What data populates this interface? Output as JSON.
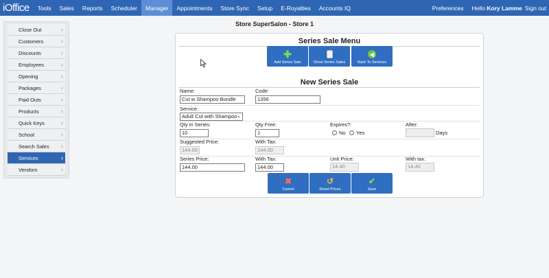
{
  "app": {
    "logo": "iOffice"
  },
  "nav": {
    "items": [
      "Tools",
      "Sales",
      "Reports",
      "Scheduler",
      "Manager",
      "Appointments",
      "Store Sync",
      "Setup",
      "E-Royalties",
      "Accounts IQ"
    ],
    "active": "Manager",
    "preferences": "Preferences",
    "hello": "Hello",
    "user": "Kory Lamme",
    "signout": "Sign out"
  },
  "sidebar": {
    "items": [
      "Close Out",
      "Customers",
      "Discounts",
      "Employees",
      "Opening",
      "Packages",
      "Paid Outs",
      "Products",
      "Quick Keys",
      "School",
      "Search Sales",
      "Services",
      "Vendors"
    ],
    "active": "Services"
  },
  "store_title": "Store SuperSalon - Store 1",
  "menu": {
    "title": "Series Sale Menu",
    "buttons": {
      "add": "Add Series Sale",
      "show": "Show Series Sales",
      "back": "Back To Services"
    }
  },
  "form": {
    "title": "New Series Sale",
    "name_label": "Name:",
    "name_value": "Cut w Shampoo Bundle",
    "code_label": "Code:",
    "code_value": "1356",
    "service_label": "Service:",
    "service_value": "Adult Cut with Shampoo",
    "qty_series_label": "Qty in Series:",
    "qty_series_value": "10",
    "qty_free_label": "Qty Free:",
    "qty_free_value": "1",
    "expires_label": "Expires?:",
    "expires_no": "No",
    "expires_yes": "Yes",
    "after_label": "After:",
    "after_value": "",
    "days_label": "Days",
    "suggested_label": "Suggested Price:",
    "suggested_value": "144.00",
    "with_tax_label": "With Tax:",
    "suggested_tax_value": "144.00",
    "series_price_label": "Series Price:",
    "series_price_value": "144.00",
    "series_tax_label": "With Tax:",
    "series_tax_value": "144.00",
    "unit_price_label": "Unit Price:",
    "unit_price_value": "14.40",
    "unit_tax_label": "With tax:",
    "unit_tax_value": "14.40"
  },
  "actions": {
    "cancel": "Cancel",
    "reset": "Reset Prices",
    "save": "Save"
  },
  "colors": {
    "brand": "#2f66b4",
    "button": "#2f6ec0"
  }
}
